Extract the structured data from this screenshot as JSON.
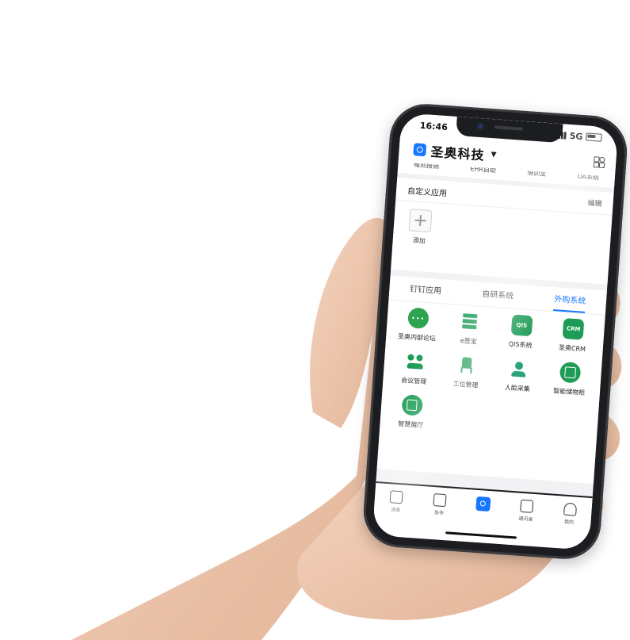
{
  "status_bar": {
    "time": "16:46",
    "network": "5G"
  },
  "header": {
    "title": "圣奥科技",
    "dropdown_icon": "caret-down-icon",
    "action_icon": "grid-scan-icon"
  },
  "shortcuts": [
    "每刻报销",
    "EHR自助",
    "培训宝",
    "OA系统"
  ],
  "custom_apps": {
    "title": "自定义应用",
    "edit_label": "编辑",
    "add_label": "添加"
  },
  "app_tabs": {
    "items": [
      "钉钉应用",
      "自研系统",
      "外购系统"
    ],
    "active": "外购系统"
  },
  "apps": [
    {
      "label": "圣奥内部论坛",
      "icon": "chat-icon"
    },
    {
      "label": "e签宝",
      "icon": "list-icon"
    },
    {
      "label": "QIS系统",
      "icon": "qis-icon",
      "badge": "QIS"
    },
    {
      "label": "圣奥CRM",
      "icon": "crm-icon",
      "badge": "CRM"
    },
    {
      "label": "会议管理",
      "icon": "meeting-icon"
    },
    {
      "label": "工位管理",
      "icon": "workstation-icon"
    },
    {
      "label": "人脸采集",
      "icon": "face-icon"
    },
    {
      "label": "智能储物柜",
      "icon": "locker-icon"
    },
    {
      "label": "智慧展厅",
      "icon": "showroom-icon"
    }
  ],
  "bottom_nav": [
    "消息",
    "协作",
    "",
    "通讯录",
    "我的"
  ],
  "colors": {
    "accent": "#1677ff",
    "app_green": "#1e9c57"
  }
}
